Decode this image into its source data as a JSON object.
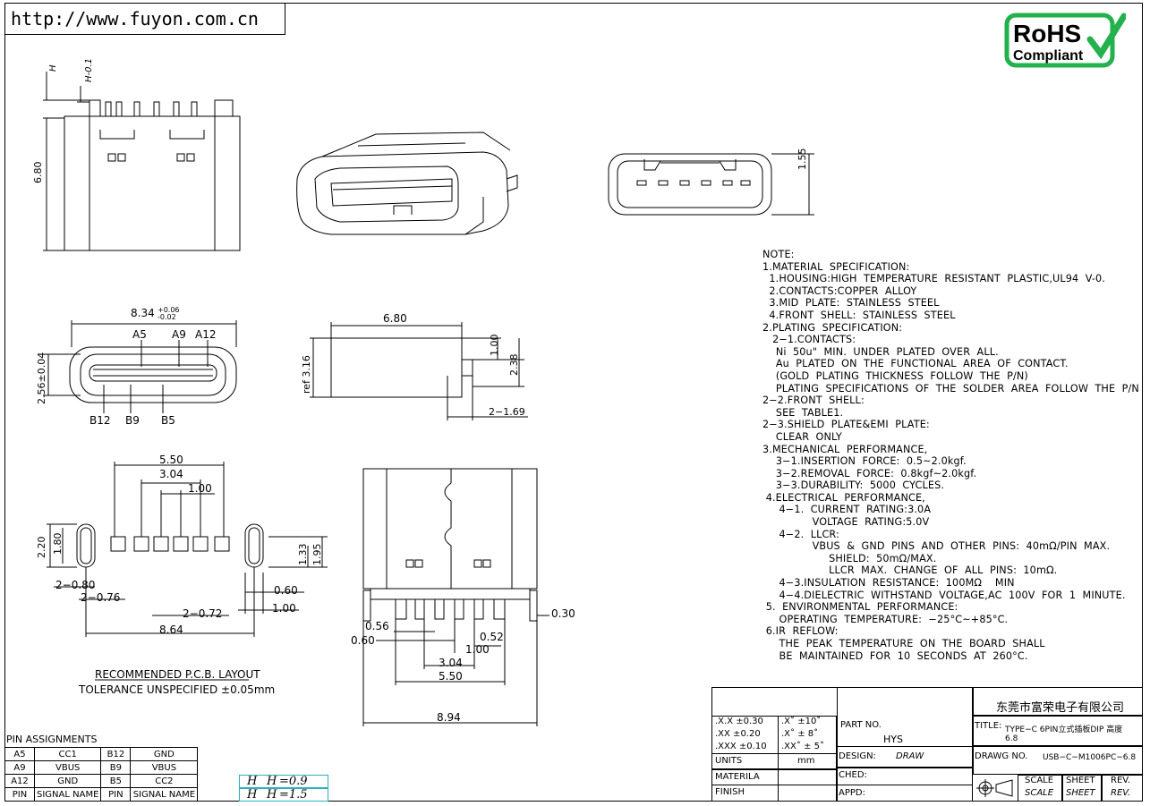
{
  "url": "http://www.fuyon.com.cn",
  "rohs": {
    "line1": "RoHS",
    "line2": "Compliant",
    "color": "#22b14c"
  },
  "dims": {
    "h": "H",
    "h01": "H-0.1",
    "d680v": "6.80",
    "d155": "1.55",
    "d834": "8.34",
    "d834tol_up": "+0.06",
    "d834tol_dn": "-0.02",
    "a5": "A5",
    "a9": "A9",
    "a12": "A12",
    "b12": "B12",
    "b9": "B9",
    "b5": "B5",
    "d256": "2.56±0.04",
    "d680h": "6.80",
    "d100a": "1.00",
    "d238": "2.38",
    "ref316": "ref 3.16",
    "d2_169": "2−1.69",
    "d550a": "5.50",
    "d304a": "3.04",
    "d100b": "1.00",
    "d220": "2.20",
    "d180": "1.80",
    "d133": "1.33",
    "d195": "1.95",
    "d2_080": "2−0.80",
    "d2_076": "2−0.76",
    "d2_072": "2−0.72",
    "d060a": "0.60",
    "d100c": "1.00",
    "d864": "8.64",
    "pcb_title": "RECOMMENDED  P.C.B. LAYOUT",
    "pcb_tol": "TOLERANCE UNSPECIFIED ±0.05mm",
    "d030": "0.30",
    "d056": "0.56",
    "d060b": "0.60",
    "d052": "0.52",
    "d100d": "1.00",
    "d304b": "3.04",
    "d550b": "5.50",
    "d894": "8.94"
  },
  "notes": [
    "NOTE:",
    "1.MATERIAL  SPECIFICATION:",
    "  1.HOUSING:HIGH  TEMPERATURE  RESISTANT  PLASTIC,UL94  V-0.",
    "  2.CONTACTS:COPPER  ALLOY",
    "  3.MID  PLATE:  STAINLESS  STEEL",
    "  4.FRONT  SHELL:  STAINLESS  STEEL",
    "2.PLATING  SPECIFICATION:",
    "   2−1.CONTACTS:",
    "    Ni  50u\"  MIN.  UNDER  PLATED  OVER  ALL.",
    "    Au  PLATED  ON  THE  FUNCTIONAL  AREA  OF  CONTACT.",
    "    (GOLD  PLATING  THICKNESS  FOLLOW  THE  P/N)",
    "    PLATING  SPECIFICATIONS  OF  THE  SOLDER  AREA  FOLLOW  THE  P/N",
    "2−2.FRONT  SHELL:",
    "    SEE  TABLE1.",
    "2−3.SHIELD  PLATE&EMI  PLATE:",
    "    CLEAR  ONLY",
    "3.MECHANICAL  PERFORMANCE,",
    "    3−1.INSERTION  FORCE:  0.5~2.0kgf.",
    "    3−2.REMOVAL  FORCE:  0.8kgf~2.0kgf.",
    "    3−3.DURABILITY:  5000  CYCLES.",
    " 4.ELECTRICAL  PERFORMANCE,",
    "     4−1.  CURRENT  RATING:3.0A",
    "               VOLTAGE  RATING:5.0V",
    "     4−2.  LLCR:",
    "               VBUS  &  GND  PINS  AND  OTHER  PINS:  40mΩ/PIN  MAX.",
    "                    SHIELD:  50mΩ/MAX.",
    "                    LLCR  MAX.  CHANGE  OF  ALL  PINS:  10mΩ.",
    "     4−3.INSULATION  RESISTANCE:  100MΩ    MIN",
    "     4−4.DIELECTRIC  WITHSTAND  VOLTAGE,AC  100V  FOR  1  MINUTE.",
    " 5.  ENVIRONMENTAL  PERFORMANCE:",
    "     OPERATING  TEMPERATURE:  −25°C~+85°C.",
    " 6.IR  REFLOW:",
    "     THE  PEAK  TEMPERATURE  ON  THE  BOARD  SHALL",
    "     BE  MAINTAINED  FOR  10  SECONDS  AT  260°C."
  ],
  "pin_table": {
    "title": "PIN  ASSIGNMENTS",
    "rows": [
      [
        "A5",
        "CC1",
        "B12",
        "GND"
      ],
      [
        "A9",
        "VBUS",
        "B9",
        "VBUS"
      ],
      [
        "A12",
        "GND",
        "B5",
        "CC2"
      ],
      [
        "PIN",
        "SIGNAL NAME",
        "PIN",
        "SIGNAL NAME"
      ]
    ]
  },
  "h_options": [
    {
      "sym1": "H",
      "sym2": "H",
      "val": "=0.9"
    },
    {
      "sym1": "H",
      "sym2": "H",
      "val": "=1.5"
    }
  ],
  "title_block": {
    "company": "东莞市富荣电子有限公司",
    "tol1": ".X.X    ±0.30",
    "tol1b": ".X˚    ±10˚",
    "tol2": ".XX    ±0.20",
    "tol2b": ".X˚    ±  8˚",
    "tol3": ".XXX  ±0.10",
    "tol3b": ".XX˚  ±  5˚",
    "units_label": "UNITS",
    "units": "mm",
    "materila": "MATERILA",
    "finish": "FINISH",
    "part_no_label": "PART  NO.",
    "part_no": "HYS",
    "design_label": "DESIGN:",
    "design": "DRAW",
    "ched": "CHED:",
    "appd": "APPD:",
    "title_label": "TITLE:",
    "title": "TYPE−C  6PIN立式插板DIP  高度",
    "title2": "6.8",
    "drawg_label": "DRAWG  NO.",
    "drawg": "USB−C−M1006PC−6.8",
    "scale": "SCALE",
    "sheet": "SHEET",
    "rev": "REV."
  }
}
